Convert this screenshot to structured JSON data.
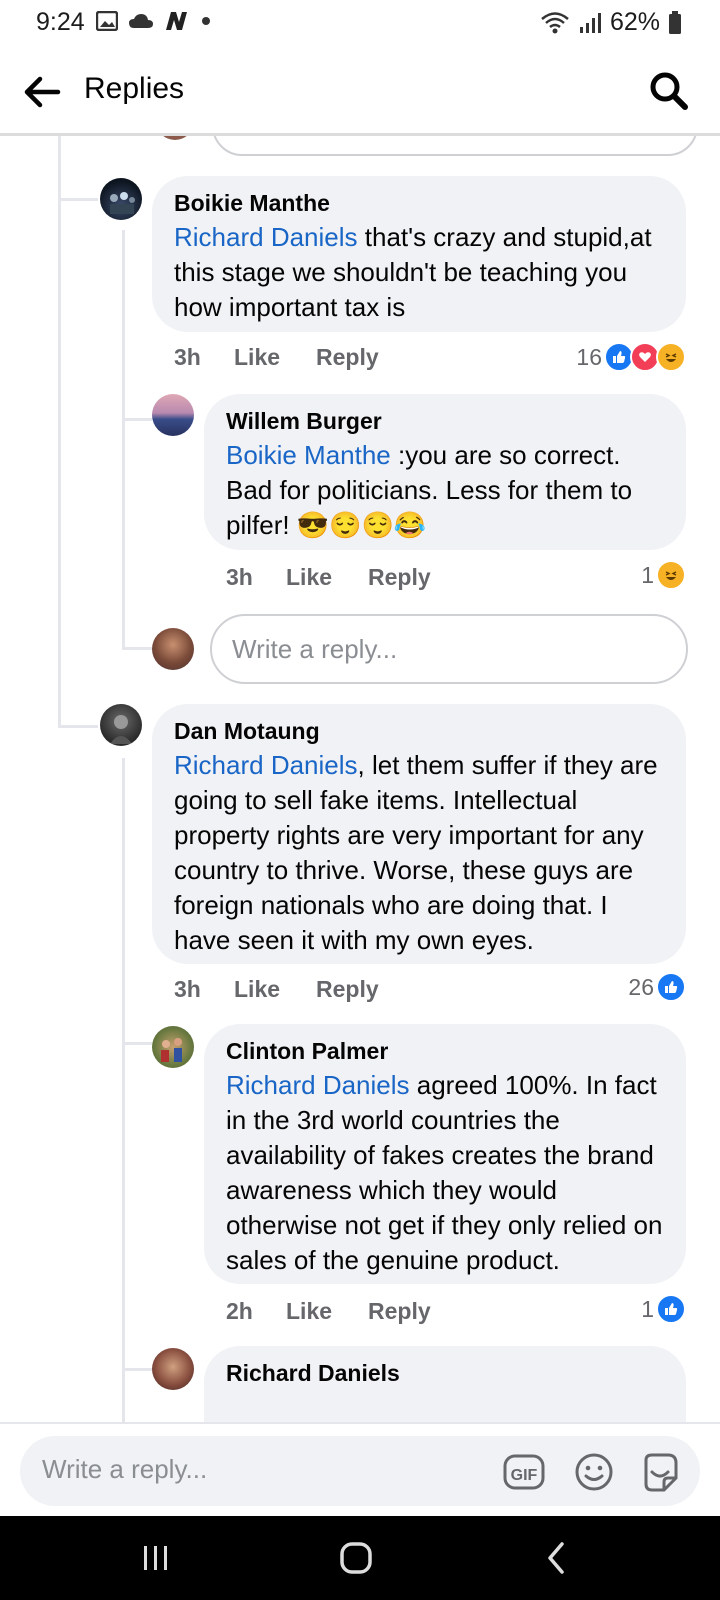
{
  "status_bar": {
    "time": "9:24",
    "battery": "62%"
  },
  "header": {
    "title": "Replies"
  },
  "comments": {
    "boikie": {
      "author": "Boikie Manthe",
      "mention": "Richard Daniels",
      "text": " that's crazy and stupid,at this stage we shouldn't be teaching you how important tax is",
      "time": "3h",
      "like": "Like",
      "reply": "Reply",
      "reactions_count": "16"
    },
    "willem": {
      "author": "Willem Burger",
      "mention": "Boikie Manthe",
      "text": " :you are so correct. Bad for politicians. Less for them to pilfer! ",
      "emojis": "😎😌😌😂",
      "time": "3h",
      "like": "Like",
      "reply": "Reply",
      "reactions_count": "1"
    },
    "dan": {
      "author": "Dan Motaung",
      "mention": "Richard Daniels",
      "text": ", let them suffer if they are going to sell fake items. Intellectual property rights are very important for any country to thrive. Worse, these guys are foreign nationals who are doing that. I have seen it with my own eyes.",
      "time": "3h",
      "like": "Like",
      "reply": "Reply",
      "reactions_count": "26"
    },
    "clinton": {
      "author": "Clinton Palmer",
      "mention": "Richard Daniels",
      "text": " agreed 100%. In fact in the 3rd world countries the availability of fakes creates the brand awareness which they would otherwise not get if they only relied on sales of the genuine product.",
      "time": "2h",
      "like": "Like",
      "reply": "Reply",
      "reactions_count": "1"
    },
    "richard": {
      "author": "Richard Daniels"
    }
  },
  "inline_reply": {
    "placeholder": "Write a reply..."
  },
  "composer": {
    "placeholder": "Write a reply...",
    "gif_label": "GIF"
  },
  "colors": {
    "mention": "#1a66c7",
    "like_blue": "#1877f2",
    "love_red": "#f33e58",
    "haha_yellow": "#f7b125"
  },
  "icons": [
    "back-arrow-icon",
    "search-icon",
    "gif-icon",
    "emoji-icon",
    "sticker-icon",
    "like-reaction-icon",
    "love-reaction-icon",
    "haha-reaction-icon"
  ]
}
